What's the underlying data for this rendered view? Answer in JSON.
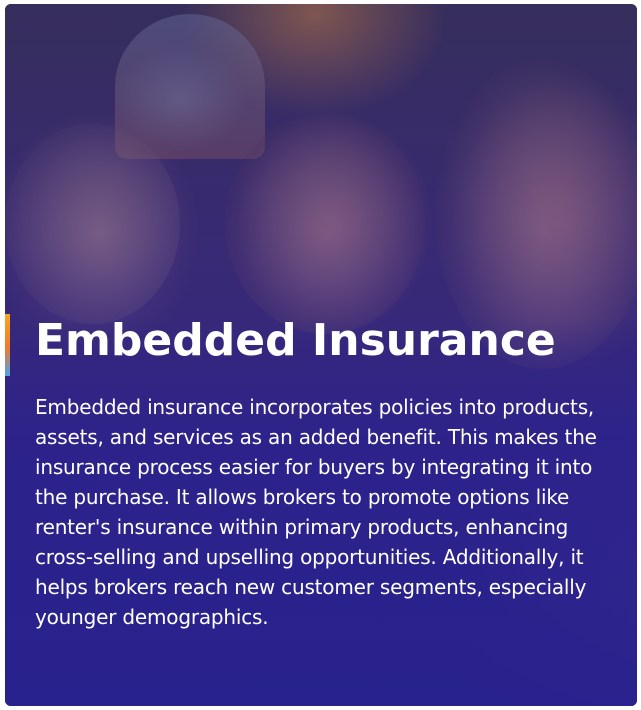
{
  "card": {
    "title": "Embedded Insurance",
    "description": "Embedded insurance incorporates policies into products, assets, and services as an added benefit. This makes the insurance process easier for buyers by integrating it into the purchase. It allows brokers to promote options like renter's insurance within primary products, enhancing cross-selling and upselling opportunities. Additionally, it helps brokers reach new customer segments, especially younger demographics."
  },
  "colors": {
    "overlay": "#2c2290",
    "accent_top": "#f5a623",
    "accent_bottom": "#4aa3e8",
    "text": "#ffffff"
  }
}
